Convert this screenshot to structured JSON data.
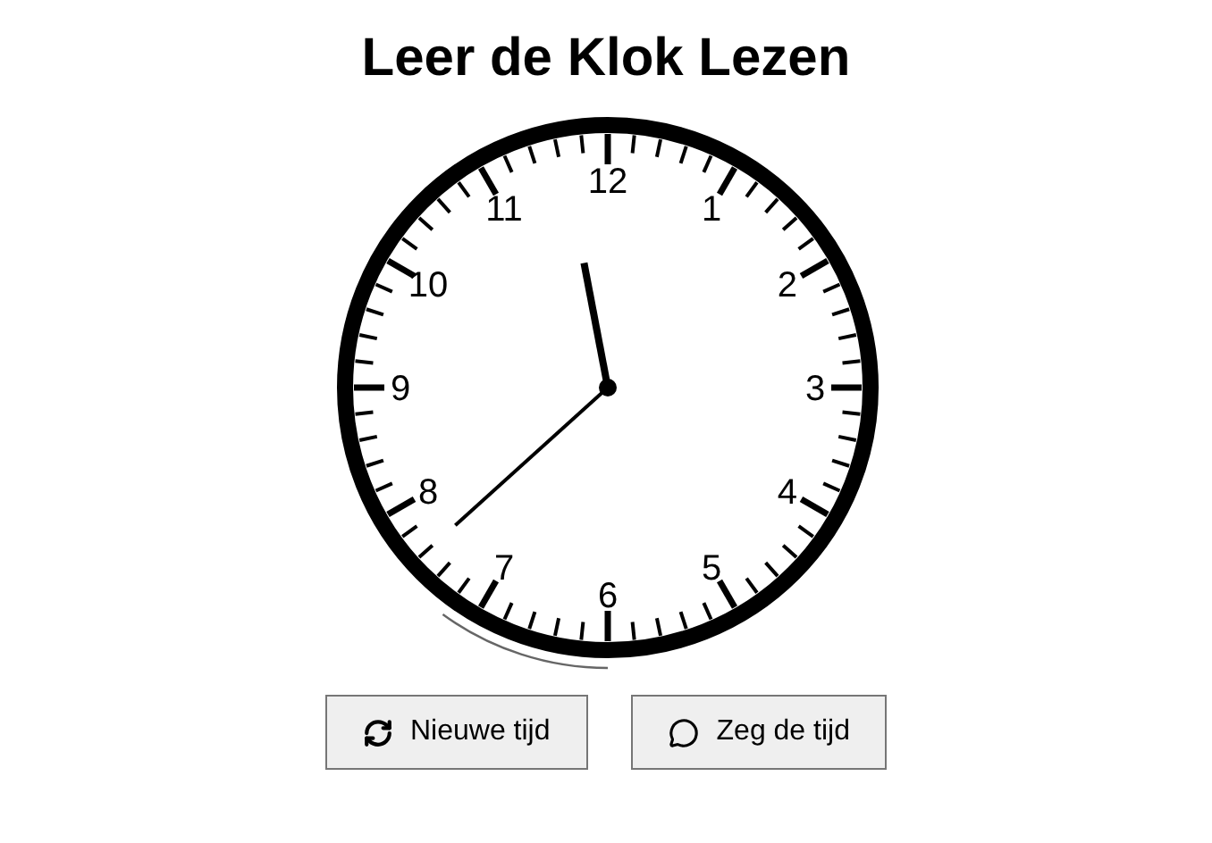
{
  "title": "Leer de Klok Lezen",
  "clock": {
    "numbers": [
      "12",
      "1",
      "2",
      "3",
      "4",
      "5",
      "6",
      "7",
      "8",
      "9",
      "10",
      "11"
    ]
  },
  "buttons": [
    {
      "kind": "refresh",
      "label": "Nieuwe tijd"
    },
    {
      "kind": "speak",
      "label": "Zeg de tijd"
    }
  ]
}
